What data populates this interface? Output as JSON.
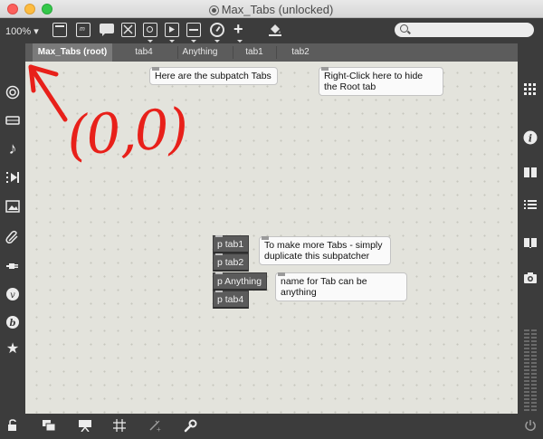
{
  "window": {
    "title": "Max_Tabs (unlocked)",
    "controls": [
      "close",
      "minimize",
      "zoom"
    ]
  },
  "toolbar": {
    "zoom_value": "100%",
    "icons": [
      "presentation-icon",
      "message-icon",
      "comment-icon",
      "toggle-icon",
      "button-icon",
      "object-icon",
      "slider-icon",
      "dial-icon",
      "add-icon",
      "paint-bucket-icon"
    ],
    "search_placeholder": ""
  },
  "tabs": [
    {
      "label": "Max_Tabs (root)",
      "active": true
    },
    {
      "label": "tab4",
      "active": false
    },
    {
      "label": "Anything",
      "active": false
    },
    {
      "label": "tab1",
      "active": false
    },
    {
      "label": "tab2",
      "active": false
    }
  ],
  "canvas": {
    "comments": [
      "Here are the subpatch Tabs",
      "Right-Click here to hide the Root tab",
      "To make more Tabs - simply duplicate this subpatcher",
      "name for Tab can be anything"
    ],
    "objects": [
      "p tab1",
      "p tab2",
      "p Anything",
      "p tab4"
    ],
    "annotation_text": "(0,0)",
    "annotation_color": "#e8201a"
  },
  "left_sidebar": {
    "icons": [
      "target-icon",
      "transport-icon",
      "music-note-icon",
      "media-play-icon",
      "image-icon",
      "clip-icon",
      "plug-icon",
      "vst-icon",
      "beap-icon",
      "star-icon"
    ]
  },
  "right_sidebar": {
    "icons": [
      "grid-icon",
      "info-icon",
      "book-icon",
      "list-icon",
      "reference-book-icon",
      "camera-icon",
      "level-meter-icon"
    ]
  },
  "bottom_bar": {
    "icons": [
      "lock-icon",
      "window-stack-icon",
      "presentation-icon",
      "grid-toggle-icon",
      "snap-icon",
      "wrench-icon",
      "power-icon"
    ]
  },
  "colors": {
    "canvas": "#e3e3dc",
    "chrome": "#3c3c3c",
    "tab_active": "#7a7a7a",
    "annotation": "#e8201a"
  }
}
